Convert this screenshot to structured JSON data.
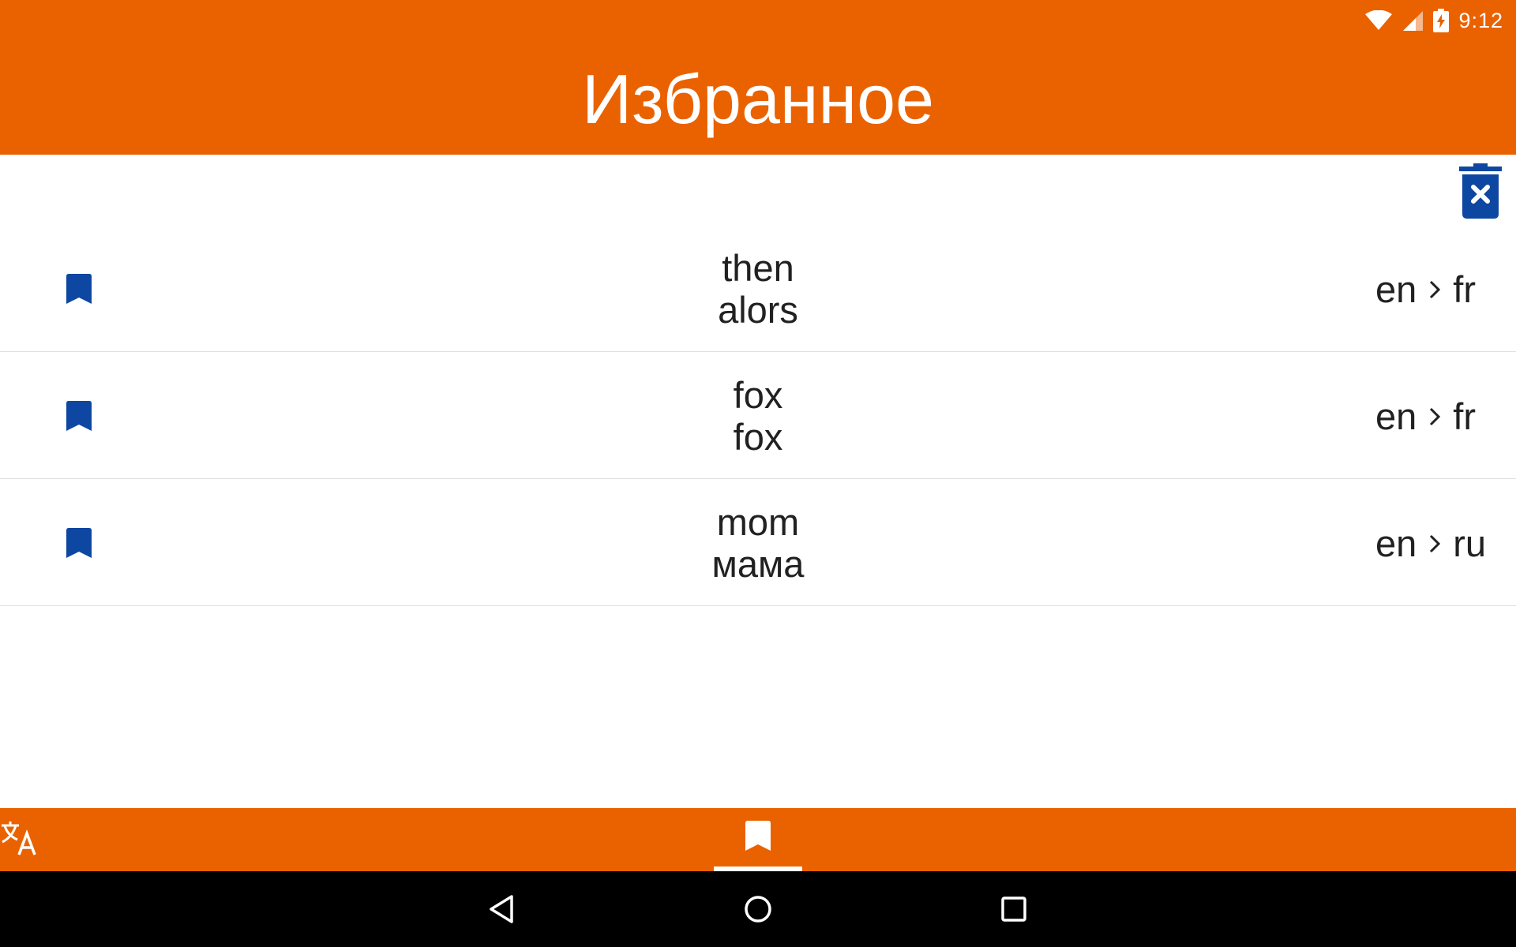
{
  "status_bar": {
    "time": "9:12",
    "icons": [
      "wifi-icon",
      "signal-icon",
      "battery-charging-icon"
    ]
  },
  "appbar": {
    "title": "Избранное"
  },
  "toolbar": {
    "clear_icon": "delete-forever-icon"
  },
  "favorites": [
    {
      "source": "then",
      "translation": "alors",
      "from": "en",
      "to": "fr"
    },
    {
      "source": "fox",
      "translation": "fox",
      "from": "en",
      "to": "fr"
    },
    {
      "source": "mom",
      "translation": "мама",
      "from": "en",
      "to": "ru"
    }
  ],
  "bottom_nav": {
    "items": [
      {
        "icon": "translate-icon",
        "selected": false
      },
      {
        "icon": "bookmark-icon",
        "selected": true
      }
    ]
  },
  "system_nav": {
    "buttons": [
      "back-icon",
      "home-icon",
      "recents-icon"
    ]
  },
  "colors": {
    "accent": "#EA6200",
    "icon_blue": "#0D47A1",
    "text": "#212121",
    "divider": "#E0E0E0"
  }
}
